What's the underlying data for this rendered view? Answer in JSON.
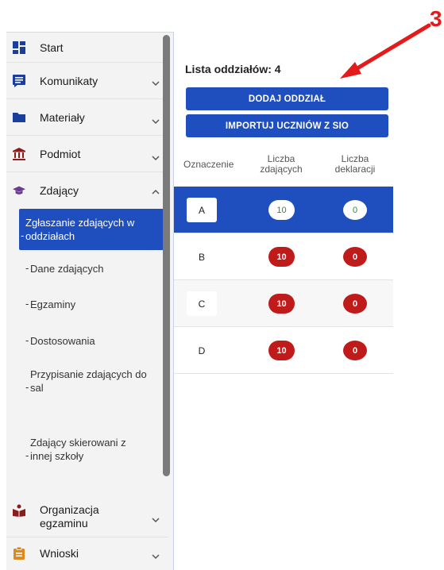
{
  "annotation": {
    "number": "3",
    "color": "#e31b1b"
  },
  "sidebar": {
    "items": [
      {
        "label": "Start",
        "icon": "dashboard-icon",
        "expandable": false
      },
      {
        "label": "Komunikaty",
        "icon": "message-icon",
        "expandable": true,
        "expanded": false
      },
      {
        "label": "Materiały",
        "icon": "folder-icon",
        "expandable": true,
        "expanded": false
      },
      {
        "label": "Podmiot",
        "icon": "institution-icon",
        "expandable": true,
        "expanded": false
      },
      {
        "label": "Zdający",
        "icon": "graduation-cap-icon",
        "expandable": true,
        "expanded": true
      },
      {
        "label": "Organizacja egzaminu",
        "icon": "reading-person-icon",
        "expandable": true,
        "expanded": false
      },
      {
        "label": "Wnioski",
        "icon": "clipboard-icon",
        "expandable": true,
        "expanded": false
      }
    ],
    "subitems": [
      {
        "label": "Zgłaszanie zdających w oddziałach",
        "active": true
      },
      {
        "label": "Dane zdających",
        "active": false
      },
      {
        "label": "Egzaminy",
        "active": false
      },
      {
        "label": "Dostosowania",
        "active": false
      },
      {
        "label": "Przypisanie zdających do sal",
        "active": false
      },
      {
        "label": "Zdający skierowani z innej szkoły",
        "active": false
      }
    ]
  },
  "main": {
    "list_title": "Lista oddziałów: 4",
    "add_button": "DODAJ ODDZIAŁ",
    "import_button": "IMPORTUJ UCZNIÓW Z SIO",
    "columns": [
      "Oznaczenie",
      "Liczba zdających",
      "Liczba deklaracji"
    ],
    "rows": [
      {
        "label": "A",
        "students": "10",
        "declarations": "0",
        "selected": true
      },
      {
        "label": "B",
        "students": "10",
        "declarations": "0",
        "selected": false
      },
      {
        "label": "C",
        "students": "10",
        "declarations": "0",
        "selected": false
      },
      {
        "label": "D",
        "students": "10",
        "declarations": "0",
        "selected": false
      }
    ]
  },
  "colors": {
    "primary": "#1f4fbf",
    "badge_red": "#c01b1b",
    "badge_green_text": "#2e8b3c",
    "icon_blue": "#1a3e9c",
    "icon_maroon": "#8a1c1c",
    "icon_purple": "#6a3a8c",
    "icon_orange": "#e0891b"
  }
}
